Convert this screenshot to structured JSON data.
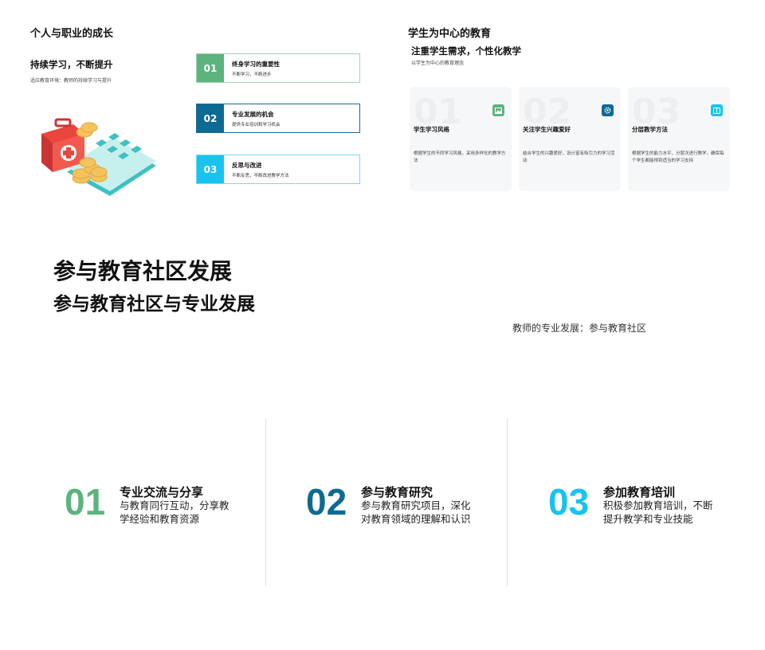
{
  "slide1": {
    "title": "个人与职业的成长",
    "subtitle": "持续学习，不断提升",
    "description": "适应教育环境：教师的持续学习与提升",
    "steps": [
      {
        "num": "01",
        "title": "终身学习的重要性",
        "desc": "不断学习，不断进步"
      },
      {
        "num": "02",
        "title": "专业发展的机会",
        "desc": "提供专业培训和学习机会"
      },
      {
        "num": "03",
        "title": "反思与改进",
        "desc": "不断反思，不断改进教学方法"
      }
    ],
    "illustration_icon": "medical-kit-calculator-coins-icon"
  },
  "slide2": {
    "title": "学生为中心的教育",
    "subtitle": "注重学生需求，个性化教学",
    "description": "以学生为中心的教育理念",
    "cards": [
      {
        "num": "01",
        "title": "学生学习风格",
        "desc": "根据学生的不同学习风格，采用多样化的教学方法",
        "icon": "image-icon"
      },
      {
        "num": "02",
        "title": "关注学生兴趣爱好",
        "desc": "结合学生的兴趣爱好，设计富有吸引力的学习活动",
        "icon": "gear-icon"
      },
      {
        "num": "03",
        "title": "分层教学方法",
        "desc": "根据学生的能力水平，分层次进行教学，确保每个学生都能得到适当的学习支持",
        "icon": "book-icon"
      }
    ]
  },
  "slide3": {
    "title": "参与教育社区发展",
    "subtitle": "参与教育社区与专业发展",
    "note": "教师的专业发展：参与教育社区"
  },
  "slide4": {
    "items": [
      {
        "num": "01",
        "title": "专业交流与分享",
        "desc": "与教育同行互动，分享教学经验和教育资源"
      },
      {
        "num": "02",
        "title": "参与教育研究",
        "desc": "参与教育研究项目，深化对教育领域的理解和认识"
      },
      {
        "num": "03",
        "title": "参加教育培训",
        "desc": "积极参加教育培训，不断提升教学和专业技能"
      }
    ]
  },
  "colors": {
    "green": "#5cb37e",
    "teal": "#0d6a93",
    "cyan": "#16c4ef"
  }
}
